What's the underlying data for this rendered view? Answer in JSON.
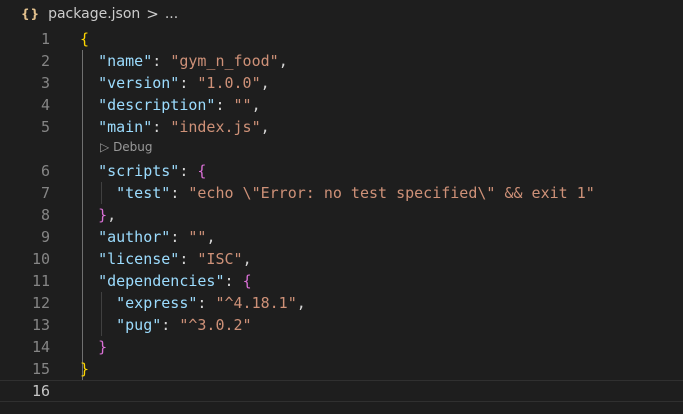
{
  "breadcrumb": {
    "file_icon": "{}",
    "file": "package.json",
    "separator": ">",
    "more": "..."
  },
  "codelens": {
    "icon": "▷",
    "label": "Debug"
  },
  "lines": [
    {
      "num": "1",
      "indent": "",
      "key": "",
      "sep": "",
      "value": "",
      "open": "{",
      "close": "",
      "trail": ""
    },
    {
      "num": "2",
      "indent": "  ",
      "key": "\"name\"",
      "sep": ": ",
      "value": "\"gym_n_food\"",
      "open": "",
      "close": "",
      "trail": ","
    },
    {
      "num": "3",
      "indent": "  ",
      "key": "\"version\"",
      "sep": ": ",
      "value": "\"1.0.0\"",
      "open": "",
      "close": "",
      "trail": ","
    },
    {
      "num": "4",
      "indent": "  ",
      "key": "\"description\"",
      "sep": ": ",
      "value": "\"\"",
      "open": "",
      "close": "",
      "trail": ","
    },
    {
      "num": "5",
      "indent": "  ",
      "key": "\"main\"",
      "sep": ": ",
      "value": "\"index.js\"",
      "open": "",
      "close": "",
      "trail": ","
    },
    {
      "num": "6",
      "indent": "  ",
      "key": "\"scripts\"",
      "sep": ": ",
      "value": "",
      "open": "{",
      "close": "",
      "trail": ""
    },
    {
      "num": "7",
      "indent": "    ",
      "key": "\"test\"",
      "sep": ": ",
      "value": "\"echo \\\"Error: no test specified\\\" && exit 1\"",
      "open": "",
      "close": "",
      "trail": ""
    },
    {
      "num": "8",
      "indent": "  ",
      "key": "",
      "sep": "",
      "value": "",
      "open": "",
      "close": "}",
      "trail": ","
    },
    {
      "num": "9",
      "indent": "  ",
      "key": "\"author\"",
      "sep": ": ",
      "value": "\"\"",
      "open": "",
      "close": "",
      "trail": ","
    },
    {
      "num": "10",
      "indent": "  ",
      "key": "\"license\"",
      "sep": ": ",
      "value": "\"ISC\"",
      "open": "",
      "close": "",
      "trail": ","
    },
    {
      "num": "11",
      "indent": "  ",
      "key": "\"dependencies\"",
      "sep": ": ",
      "value": "",
      "open": "{",
      "close": "",
      "trail": ""
    },
    {
      "num": "12",
      "indent": "    ",
      "key": "\"express\"",
      "sep": ": ",
      "value": "\"^4.18.1\"",
      "open": "",
      "close": "",
      "trail": ","
    },
    {
      "num": "13",
      "indent": "    ",
      "key": "\"pug\"",
      "sep": ": ",
      "value": "\"^3.0.2\"",
      "open": "",
      "close": "",
      "trail": ""
    },
    {
      "num": "14",
      "indent": "  ",
      "key": "",
      "sep": "",
      "value": "",
      "open": "",
      "close": "}",
      "trail": ""
    },
    {
      "num": "15",
      "indent": "",
      "key": "",
      "sep": "",
      "value": "",
      "open": "",
      "close": "}",
      "trail": ""
    },
    {
      "num": "16",
      "indent": "",
      "key": "",
      "sep": "",
      "value": "",
      "open": "",
      "close": "",
      "trail": ""
    }
  ],
  "colors": {
    "background": "#1e1e1e",
    "key": "#9cdcfe",
    "string": "#ce9178",
    "bracket_level1": "#ffd700",
    "bracket_level2": "#da70d6",
    "line_number": "#858585",
    "json_icon": "#e2c08d"
  }
}
